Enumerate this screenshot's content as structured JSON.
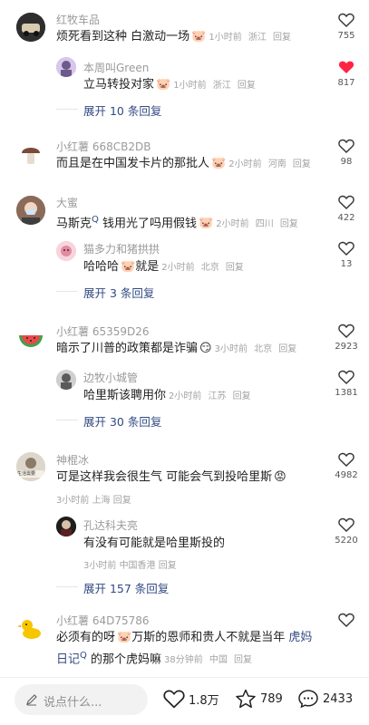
{
  "comments": [
    {
      "user": "红牧车品",
      "text": "烦死看到这种 白激动一场",
      "emoji": "pig-emoji",
      "time": "1小时前",
      "location": "浙江",
      "reply": "回复",
      "likes": "755",
      "liked": false,
      "replies": [
        {
          "user": "本周叫Green",
          "text": "立马转投对家",
          "emoji": "pig-emoji",
          "time": "1小时前",
          "location": "浙江",
          "reply": "回复",
          "likes": "817",
          "liked": true
        }
      ],
      "expand": "展开 10 条回复"
    },
    {
      "user": "小红薯 668CB2DB",
      "text": "而且是在中国发卡片的那批人",
      "emoji": "pig-emoji",
      "time": "2小时前",
      "location": "河南",
      "reply": "回复",
      "likes": "98",
      "liked": false
    },
    {
      "user": "大蜜",
      "text": "马斯克",
      "search_mark": "Q",
      "text_after": " 钱用光了吗用假钱",
      "emoji": "pig-emoji",
      "time": "2小时前",
      "location": "四川",
      "reply": "回复",
      "likes": "422",
      "liked": false,
      "replies": [
        {
          "user": "猫多力和猪拱拱",
          "text": "哈哈哈",
          "emoji": "pig-emoji",
          "text_after": "就是",
          "time": "2小时前",
          "location": "北京",
          "reply": "回复",
          "likes": "13",
          "liked": false
        }
      ],
      "expand": "展开 3 条回复"
    },
    {
      "user": "小红薯 65359D26",
      "text": "暗示了川普的政策都是诈骗",
      "emoji": "cheeky-emoji",
      "time": "3小时前",
      "location": "北京",
      "reply": "回复",
      "likes": "2923",
      "liked": false,
      "replies": [
        {
          "user": "边牧小城管",
          "text": "哈里斯该聘用你",
          "time": "2小时前",
          "location": "江苏",
          "reply": "回复",
          "likes": "1381",
          "liked": false
        }
      ],
      "expand": "展开 30 条回复"
    },
    {
      "user": "神棍冰",
      "text": "可是这样我会很生气 可能会气到投哈里斯",
      "emoji": "angry-emoji",
      "time": "3小时前",
      "location": "上海",
      "reply": "回复",
      "likes": "4982",
      "liked": false,
      "avatar_text": "生活需要",
      "replies": [
        {
          "user": "孔达科夫亮",
          "text": "有没有可能就是哈里斯投的",
          "time": "3小时前",
          "location": "中国香港",
          "reply": "回复",
          "likes": "5220",
          "liked": false
        }
      ],
      "expand": "展开 157 条回复"
    },
    {
      "user": "小红薯 64D75786",
      "text": "必须有的呀",
      "emoji": "pig-emoji",
      "text_after": "万斯的恩师和贵人不就是当年 ",
      "link1": "虎妈",
      "link2": "日记",
      "search_mark": "Q",
      "text_line2_after": " 的那个虎妈嘛",
      "time": "38分钟前",
      "location": "中国",
      "reply": "回复",
      "likes": "",
      "liked": false
    }
  ],
  "bottom_bar": {
    "placeholder": "说点什么...",
    "likes": "1.8万",
    "stars": "789",
    "comments": "2433"
  },
  "colors": {
    "liked_heart": "#ff2442",
    "link": "#324a82",
    "meta": "#a3a3a3"
  }
}
